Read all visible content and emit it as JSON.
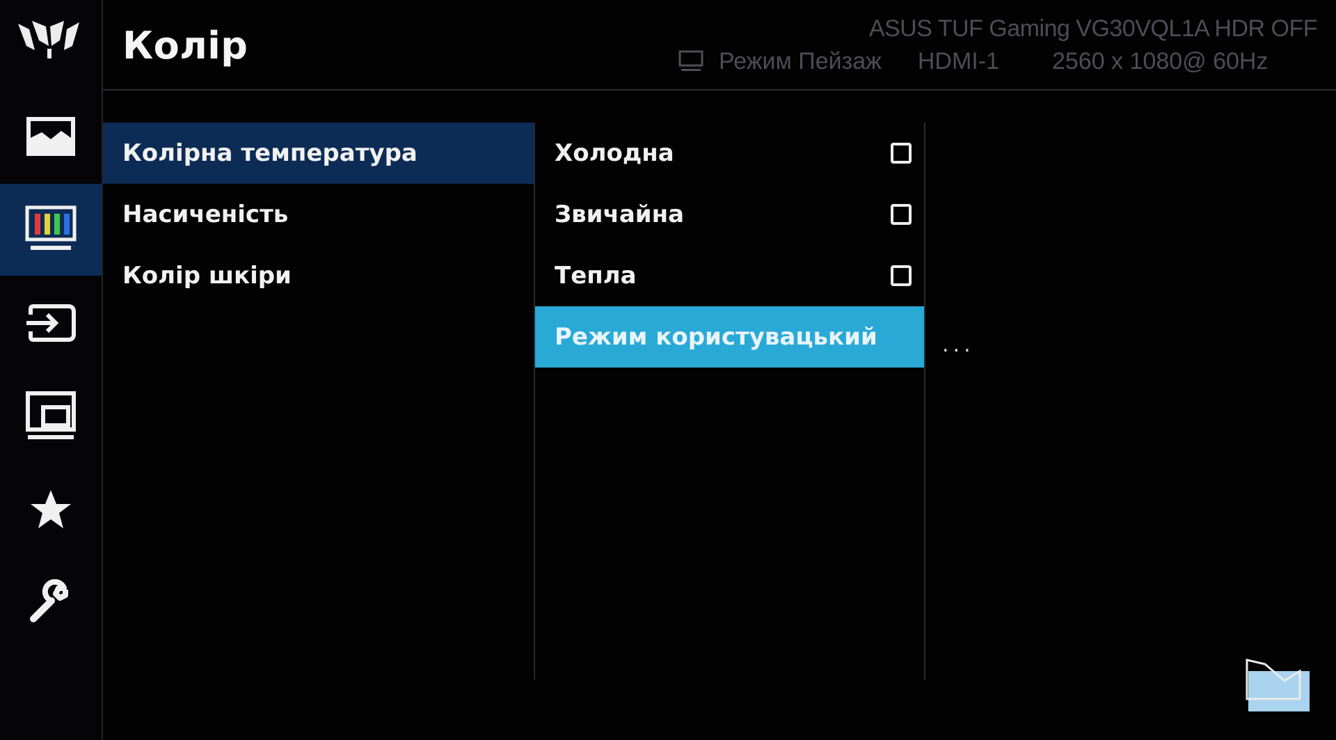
{
  "header": {
    "title": "Колір",
    "model_info": "ASUS TUF Gaming VG30VQL1A  HDR OFF",
    "mode": "Режим Пейзаж",
    "input": "HDMI-1",
    "resolution": "2560 x 1080@ 60Hz"
  },
  "sidebar": {
    "items": [
      {
        "icon": "image-icon",
        "active": false
      },
      {
        "icon": "color-bars-icon",
        "active": true
      },
      {
        "icon": "input-select-icon",
        "active": false
      },
      {
        "icon": "pip-icon",
        "active": false
      },
      {
        "icon": "star-icon",
        "active": false
      },
      {
        "icon": "wrench-icon",
        "active": false
      }
    ]
  },
  "menu": {
    "categories": [
      "Колірна температура",
      "Насиченість",
      "Колір шкіри"
    ],
    "selected_category": 0,
    "options": [
      {
        "label": "Холодна",
        "checked": false
      },
      {
        "label": "Звичайна",
        "checked": false
      },
      {
        "label": "Тепла",
        "checked": false
      },
      {
        "label": "Режим користувацький",
        "highlighted": true
      }
    ],
    "more": "..."
  },
  "colors": {
    "accent": "#0d2c55",
    "highlight": "#29a9d6",
    "background": "#020203"
  }
}
